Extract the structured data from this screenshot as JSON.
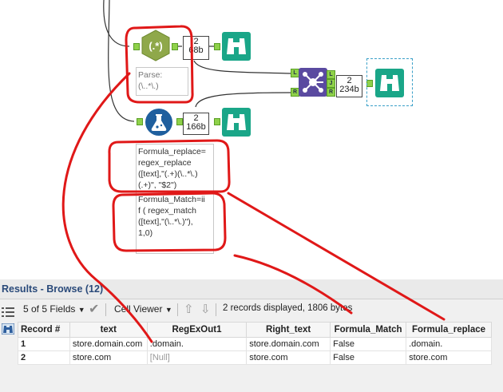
{
  "workflow": {
    "regex_tool": {
      "icon": "(.*)"
    },
    "regex_count": {
      "records": "2",
      "size": "68b"
    },
    "formula_count": {
      "records": "2",
      "size": "166b"
    },
    "join_count": {
      "records": "2",
      "size": "234b"
    },
    "join_anchors": {
      "left": "L",
      "right": "R",
      "j": "J",
      "r": "R"
    },
    "parse_annotation": "Parse:\n(\\..*\\.)",
    "formula_replace_annotation": "Formula_replace=\nregex_replace\n([text],\"(.+)(\\..*\\.)\n(.+)\", \"$2\")",
    "formula_match_annotation": "Formula_Match=ii\nf ( regex_match\n([text],\"(\\..*\\.)\"),\n1,0)"
  },
  "results": {
    "title": "Results - Browse (12)",
    "fields_label": "5 of 5 Fields",
    "viewer_label": "Cell Viewer",
    "status": "2 records displayed, 1806 bytes",
    "columns": [
      "Record #",
      "text",
      "RegExOut1",
      "Right_text",
      "Formula_Match",
      "Formula_replace"
    ],
    "rows": [
      [
        "1",
        "store.domain.com",
        ".domain.",
        "store.domain.com",
        "False",
        ".domain."
      ],
      [
        "2",
        "store.com",
        "[Null]",
        "store.com",
        "False",
        "store.com"
      ]
    ]
  },
  "colors": {
    "annotation_red": "#e01818",
    "regex_green": "#8fa84a",
    "browse_teal": "#1aa688",
    "formula_blue": "#1f5f9e",
    "join_purple": "#5a4aa0"
  }
}
